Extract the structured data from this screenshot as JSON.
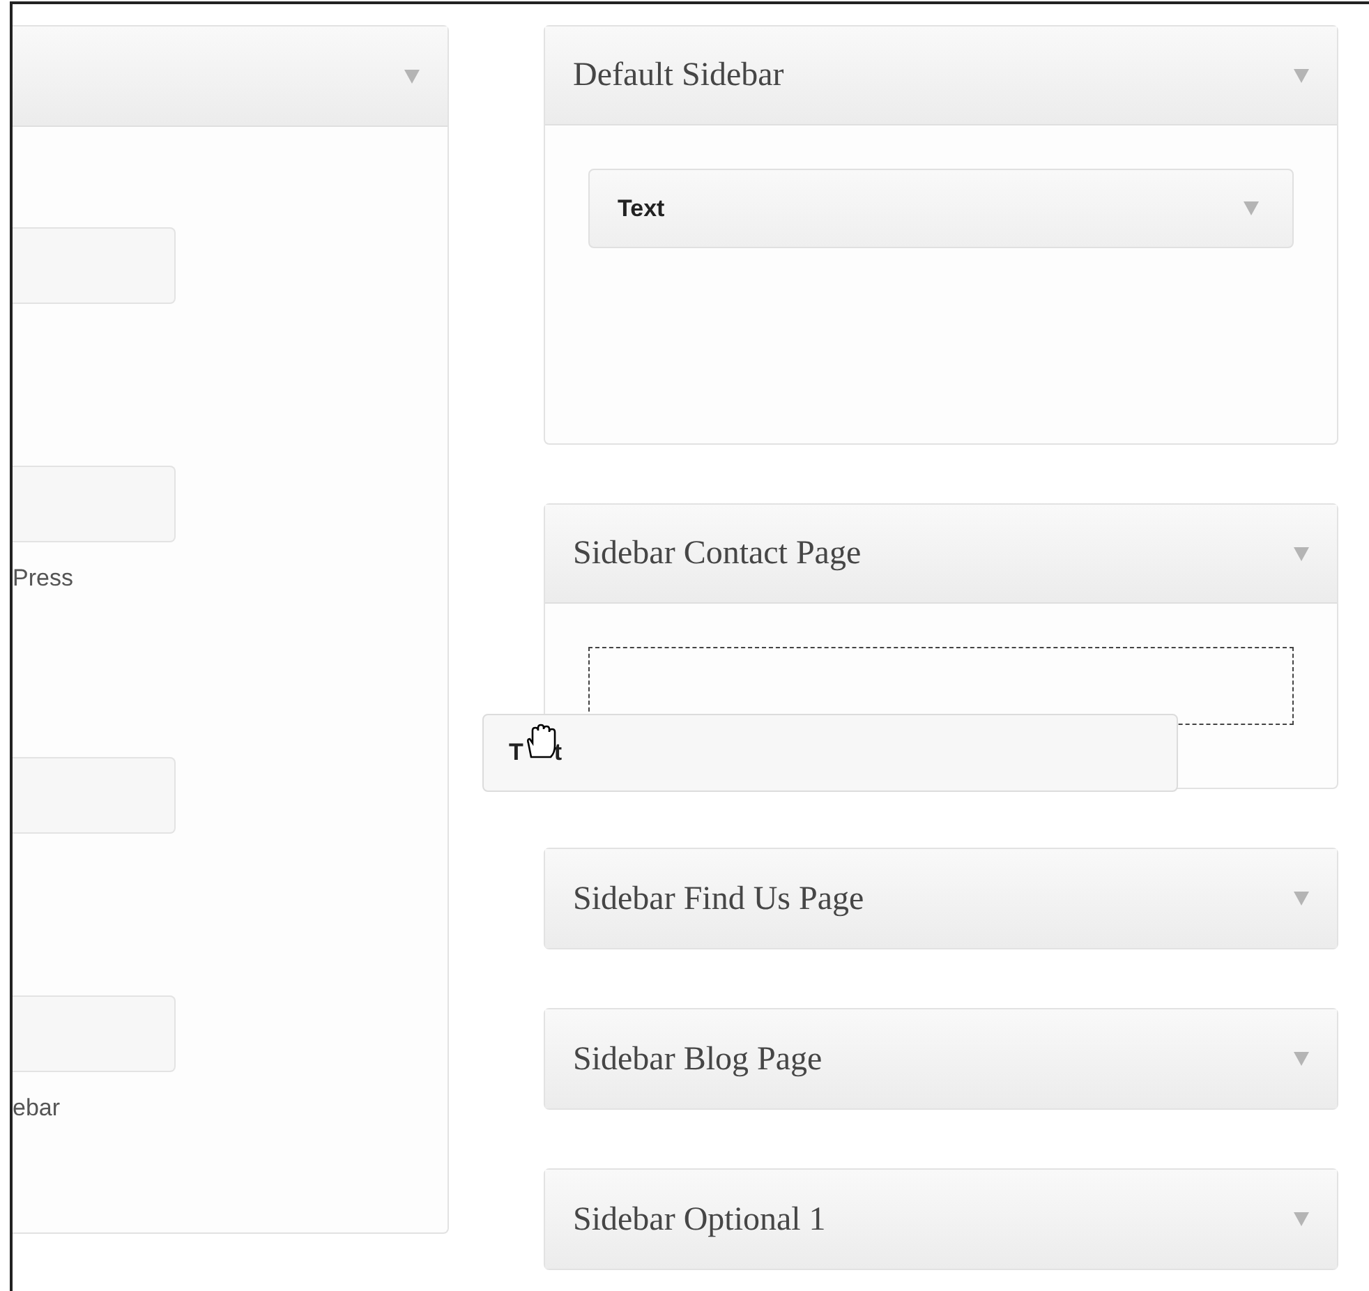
{
  "available_widgets": [
    {
      "kind": "widget"
    },
    {
      "kind": "widget",
      "description": "Press"
    },
    {
      "kind": "widget"
    },
    {
      "kind": "widget",
      "description": "ebar"
    }
  ],
  "sidebars": [
    {
      "title": "Default Sidebar",
      "expanded": true,
      "widgets": [
        {
          "title": "Text"
        }
      ]
    },
    {
      "title": "Sidebar Contact Page",
      "expanded": true,
      "drop_placeholder": true
    },
    {
      "title": "Sidebar Find Us Page",
      "expanded": false
    },
    {
      "title": "Sidebar Blog Page",
      "expanded": false
    },
    {
      "title": "Sidebar Optional 1",
      "expanded": false
    }
  ],
  "dragged_widget": {
    "title_start": "T",
    "title_end": "t"
  }
}
